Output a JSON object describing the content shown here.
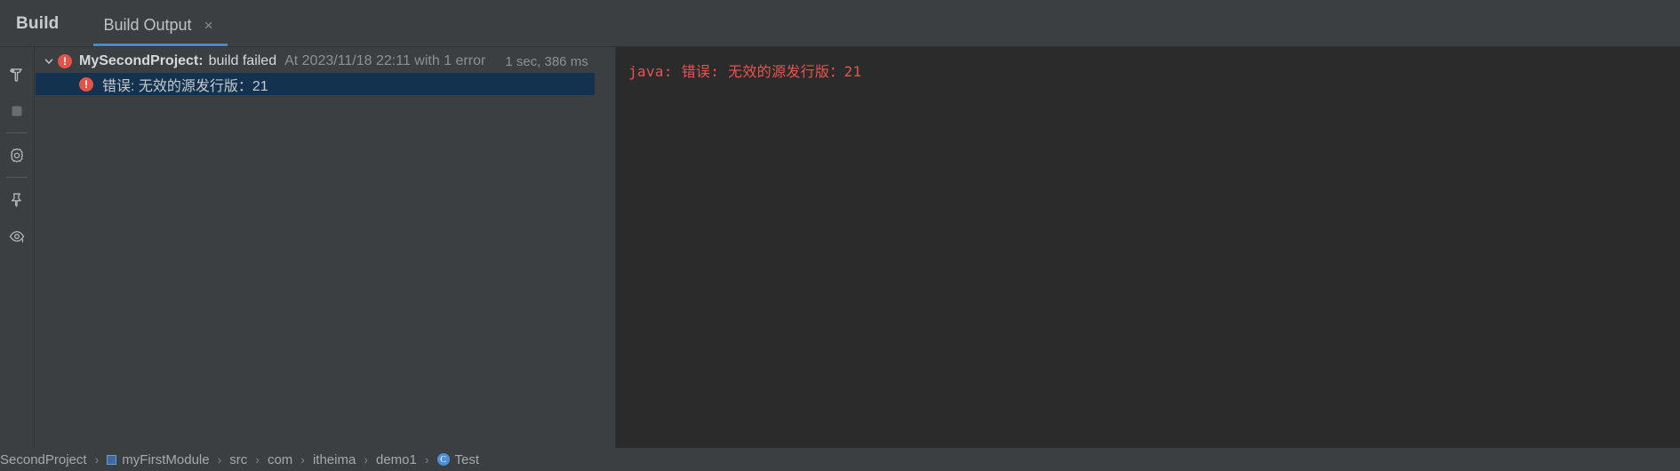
{
  "toolwindow": {
    "title": "Build"
  },
  "tabs": [
    {
      "label": "Build Output",
      "close": "×",
      "active": true
    }
  ],
  "sidebar": {
    "items": [
      {
        "name": "build-hammer-icon",
        "tooltip": "Build"
      },
      {
        "name": "stop-icon",
        "tooltip": "Stop"
      },
      {
        "name": "gear-icon",
        "tooltip": "Settings"
      },
      {
        "name": "pin-icon",
        "tooltip": "Pin Tab"
      },
      {
        "name": "eye-icon",
        "tooltip": "Show Options"
      }
    ]
  },
  "build_tree": {
    "header": {
      "project": "MySecondProject:",
      "status": "build failed",
      "meta": "At 2023/11/18 22:11 with 1 error",
      "duration": "1 sec, 386 ms",
      "expanded": true
    },
    "children": [
      {
        "text": "错误: 无效的源发行版：21",
        "selected": true,
        "severity": "error"
      }
    ]
  },
  "console": {
    "lines": [
      "java: 错误: 无效的源发行版：21"
    ]
  },
  "breadcrumb": {
    "items": [
      {
        "label": "SecondProject",
        "icon": "none"
      },
      {
        "label": "myFirstModule",
        "icon": "module"
      },
      {
        "label": "src",
        "icon": "none"
      },
      {
        "label": "com",
        "icon": "none"
      },
      {
        "label": "itheima",
        "icon": "none"
      },
      {
        "label": "demo1",
        "icon": "none"
      },
      {
        "label": "Test",
        "icon": "class"
      }
    ],
    "separator": "›"
  },
  "colors": {
    "error_red": "#e2544a",
    "selection_blue": "#133250",
    "tab_underline": "#4a88c7",
    "panel_bg": "#3c3f41",
    "console_bg": "#2b2b2b"
  }
}
